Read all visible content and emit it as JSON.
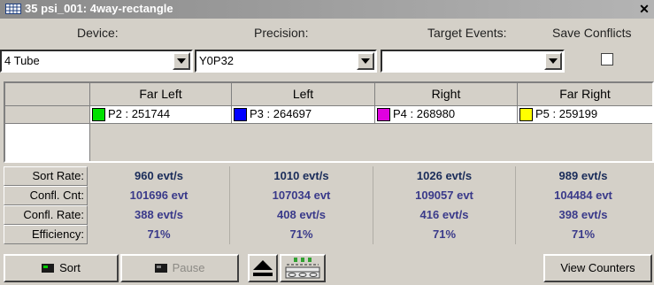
{
  "window": {
    "title": "35 psi_001: 4way-rectangle",
    "close": "✕"
  },
  "headers": {
    "device": "Device:",
    "precision": "Precision:",
    "target_events": "Target Events:",
    "save_conflicts": "Save Conflicts"
  },
  "controls": {
    "device_value": "4 Tube",
    "precision_value": "Y0P32",
    "target_events_value": "",
    "save_conflicts_checked": false
  },
  "columns": [
    {
      "label": "Far Left",
      "population": "P2 : 251744",
      "color": "#00e000"
    },
    {
      "label": "Left",
      "population": "P3 : 264697",
      "color": "#0000ff"
    },
    {
      "label": "Right",
      "population": "P4 : 268980",
      "color": "#e000e0"
    },
    {
      "label": "Far Right",
      "population": "P5 : 259199",
      "color": "#ffff00"
    }
  ],
  "stats": {
    "labels": [
      "Sort Rate:",
      "Confl. Cnt:",
      "Confl. Rate:",
      "Efficiency:"
    ],
    "sort_rate": [
      "960 evt/s",
      "1010 evt/s",
      "1026 evt/s",
      "989 evt/s"
    ],
    "confl_cnt": [
      "101696 evt",
      "107034 evt",
      "109057 evt",
      "104484 evt"
    ],
    "confl_rate": [
      "388 evt/s",
      "408 evt/s",
      "416 evt/s",
      "398 evt/s"
    ],
    "efficiency": [
      "71%",
      "71%",
      "71%",
      "71%"
    ]
  },
  "buttons": {
    "sort": "Sort",
    "pause": "Pause",
    "view_counters": "View Counters"
  },
  "icons": {
    "title": "grid-window-icon",
    "sort": "green-indicator-icon",
    "pause": "indicator-icon",
    "eject": "eject-icon",
    "tray": "sort-tray-icon"
  }
}
